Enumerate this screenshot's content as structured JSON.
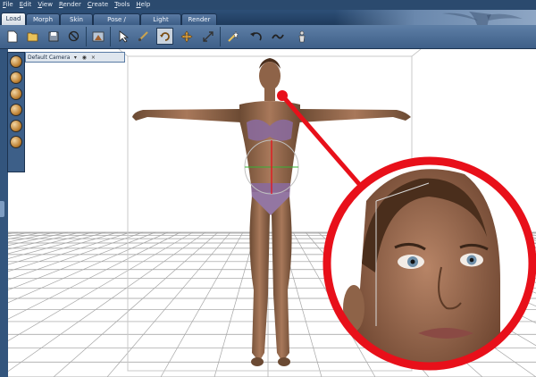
{
  "menu": [
    "File",
    "Edit",
    "View",
    "Render",
    "Create",
    "Tools",
    "Help"
  ],
  "tabs": [
    {
      "label": "Load",
      "active": true
    },
    {
      "label": "Morph",
      "active": false
    },
    {
      "label": "Skin",
      "active": false
    },
    {
      "label": "Pose / Animate",
      "active": false
    },
    {
      "label": "Light",
      "active": false
    },
    {
      "label": "Render",
      "active": false
    }
  ],
  "toolbar": {
    "icons": [
      "new-file-icon",
      "open-folder-icon",
      "save-icon",
      "cancel-icon",
      "scene-icon",
      "select-arrow-icon",
      "brush-icon",
      "rotate-icon",
      "move-icon",
      "scale-icon",
      "magic-icon",
      "undo-icon",
      "redo-icon",
      "figure-icon"
    ],
    "pressed_index": 7
  },
  "camera": {
    "label": "Default Camera",
    "controls": [
      "orbit-icon",
      "pan-icon",
      "dolly-icon",
      "roll-icon",
      "frame-icon",
      "home-icon"
    ]
  },
  "colors": {
    "accent": "#2b4a6e",
    "callout": "#e8101a"
  }
}
